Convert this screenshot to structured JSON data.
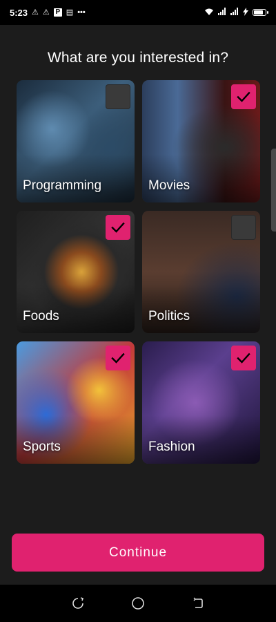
{
  "status_bar": {
    "time": "5:23",
    "icons": [
      "warning-icon",
      "warning-icon",
      "parking-icon",
      "news-icon",
      "more-dots-icon"
    ],
    "right_icons": [
      "wifi-icon",
      "signal-icon",
      "signal-icon",
      "charging-icon",
      "battery-icon"
    ],
    "battery_level": 0.85
  },
  "title": "What are you interested in?",
  "interests": [
    {
      "label": "Programming",
      "selected": false
    },
    {
      "label": "Movies",
      "selected": true
    },
    {
      "label": "Foods",
      "selected": true
    },
    {
      "label": "Politics",
      "selected": false
    },
    {
      "label": "Sports",
      "selected": true
    },
    {
      "label": "Fashion",
      "selected": true
    }
  ],
  "continue_label": "Continue",
  "colors": {
    "accent": "#e0226f",
    "background": "#1c1c1c",
    "unchecked": "#3a3a3a"
  },
  "nav": {
    "items": [
      "recent-apps-icon",
      "home-icon",
      "back-icon"
    ]
  }
}
